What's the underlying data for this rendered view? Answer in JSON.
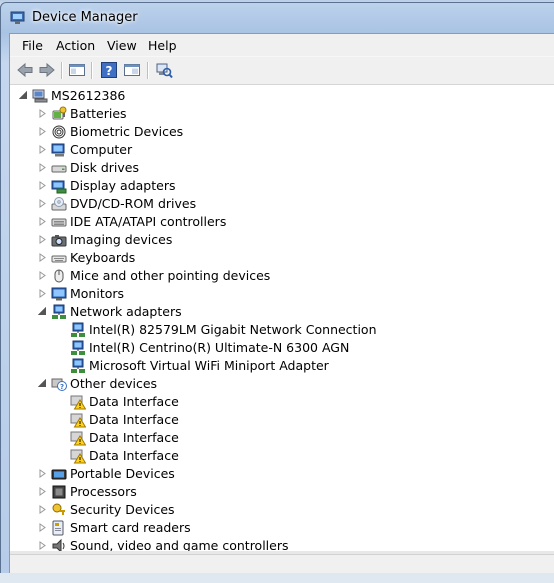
{
  "window": {
    "title": "Device Manager"
  },
  "menu": [
    "File",
    "Action",
    "View",
    "Help"
  ],
  "toolbar": {
    "buttons": [
      "back-arrow-icon",
      "forward-arrow-icon",
      "show-hide-console-tree-icon",
      "help-icon",
      "properties-pane-icon",
      "scan-hardware-changes-icon"
    ]
  },
  "tree": {
    "root": {
      "label": "MS2612386",
      "icon": "computer-root-icon",
      "expanded": true
    },
    "rows": [
      {
        "label": "Batteries",
        "level": 1,
        "icon": "battery-icon",
        "expander": "collapsed"
      },
      {
        "label": "Biometric Devices",
        "level": 1,
        "icon": "fingerprint-icon",
        "expander": "collapsed"
      },
      {
        "label": "Computer",
        "level": 1,
        "icon": "computer-icon",
        "expander": "collapsed"
      },
      {
        "label": "Disk drives",
        "level": 1,
        "icon": "disk-drive-icon",
        "expander": "collapsed"
      },
      {
        "label": "Display adapters",
        "level": 1,
        "icon": "display-adapter-icon",
        "expander": "collapsed"
      },
      {
        "label": "DVD/CD-ROM drives",
        "level": 1,
        "icon": "dvd-drive-icon",
        "expander": "collapsed"
      },
      {
        "label": "IDE ATA/ATAPI controllers",
        "level": 1,
        "icon": "ide-controller-icon",
        "expander": "collapsed"
      },
      {
        "label": "Imaging devices",
        "level": 1,
        "icon": "camera-icon",
        "expander": "collapsed"
      },
      {
        "label": "Keyboards",
        "level": 1,
        "icon": "keyboard-icon",
        "expander": "collapsed"
      },
      {
        "label": "Mice and other pointing devices",
        "level": 1,
        "icon": "mouse-icon",
        "expander": "collapsed"
      },
      {
        "label": "Monitors",
        "level": 1,
        "icon": "monitor-icon",
        "expander": "collapsed"
      },
      {
        "label": "Network adapters",
        "level": 1,
        "icon": "network-adapter-icon",
        "expander": "expanded"
      },
      {
        "label": "Intel(R) 82579LM Gigabit Network Connection",
        "level": 2,
        "icon": "network-adapter-icon",
        "expander": "none"
      },
      {
        "label": "Intel(R) Centrino(R) Ultimate-N 6300 AGN",
        "level": 2,
        "icon": "network-adapter-icon",
        "expander": "none"
      },
      {
        "label": "Microsoft Virtual WiFi Miniport Adapter",
        "level": 2,
        "icon": "network-adapter-icon",
        "expander": "none"
      },
      {
        "label": "Other devices",
        "level": 1,
        "icon": "unknown-device-icon",
        "expander": "expanded"
      },
      {
        "label": "Data Interface",
        "level": 2,
        "icon": "warning-device-icon",
        "expander": "none"
      },
      {
        "label": "Data Interface",
        "level": 2,
        "icon": "warning-device-icon",
        "expander": "none"
      },
      {
        "label": "Data Interface",
        "level": 2,
        "icon": "warning-device-icon",
        "expander": "none"
      },
      {
        "label": "Data Interface",
        "level": 2,
        "icon": "warning-device-icon",
        "expander": "none"
      },
      {
        "label": "Portable Devices",
        "level": 1,
        "icon": "portable-device-icon",
        "expander": "collapsed"
      },
      {
        "label": "Processors",
        "level": 1,
        "icon": "processor-icon",
        "expander": "collapsed"
      },
      {
        "label": "Security Devices",
        "level": 1,
        "icon": "security-key-icon",
        "expander": "collapsed"
      },
      {
        "label": "Smart card readers",
        "level": 1,
        "icon": "smart-card-icon",
        "expander": "collapsed"
      },
      {
        "label": "Sound, video and game controllers",
        "level": 1,
        "icon": "speaker-icon",
        "expander": "collapsed"
      }
    ]
  },
  "colors": {
    "client_bg": "#ffffff",
    "chrome_bg": "#f0f0f0",
    "frame": "#a9c3e3"
  }
}
